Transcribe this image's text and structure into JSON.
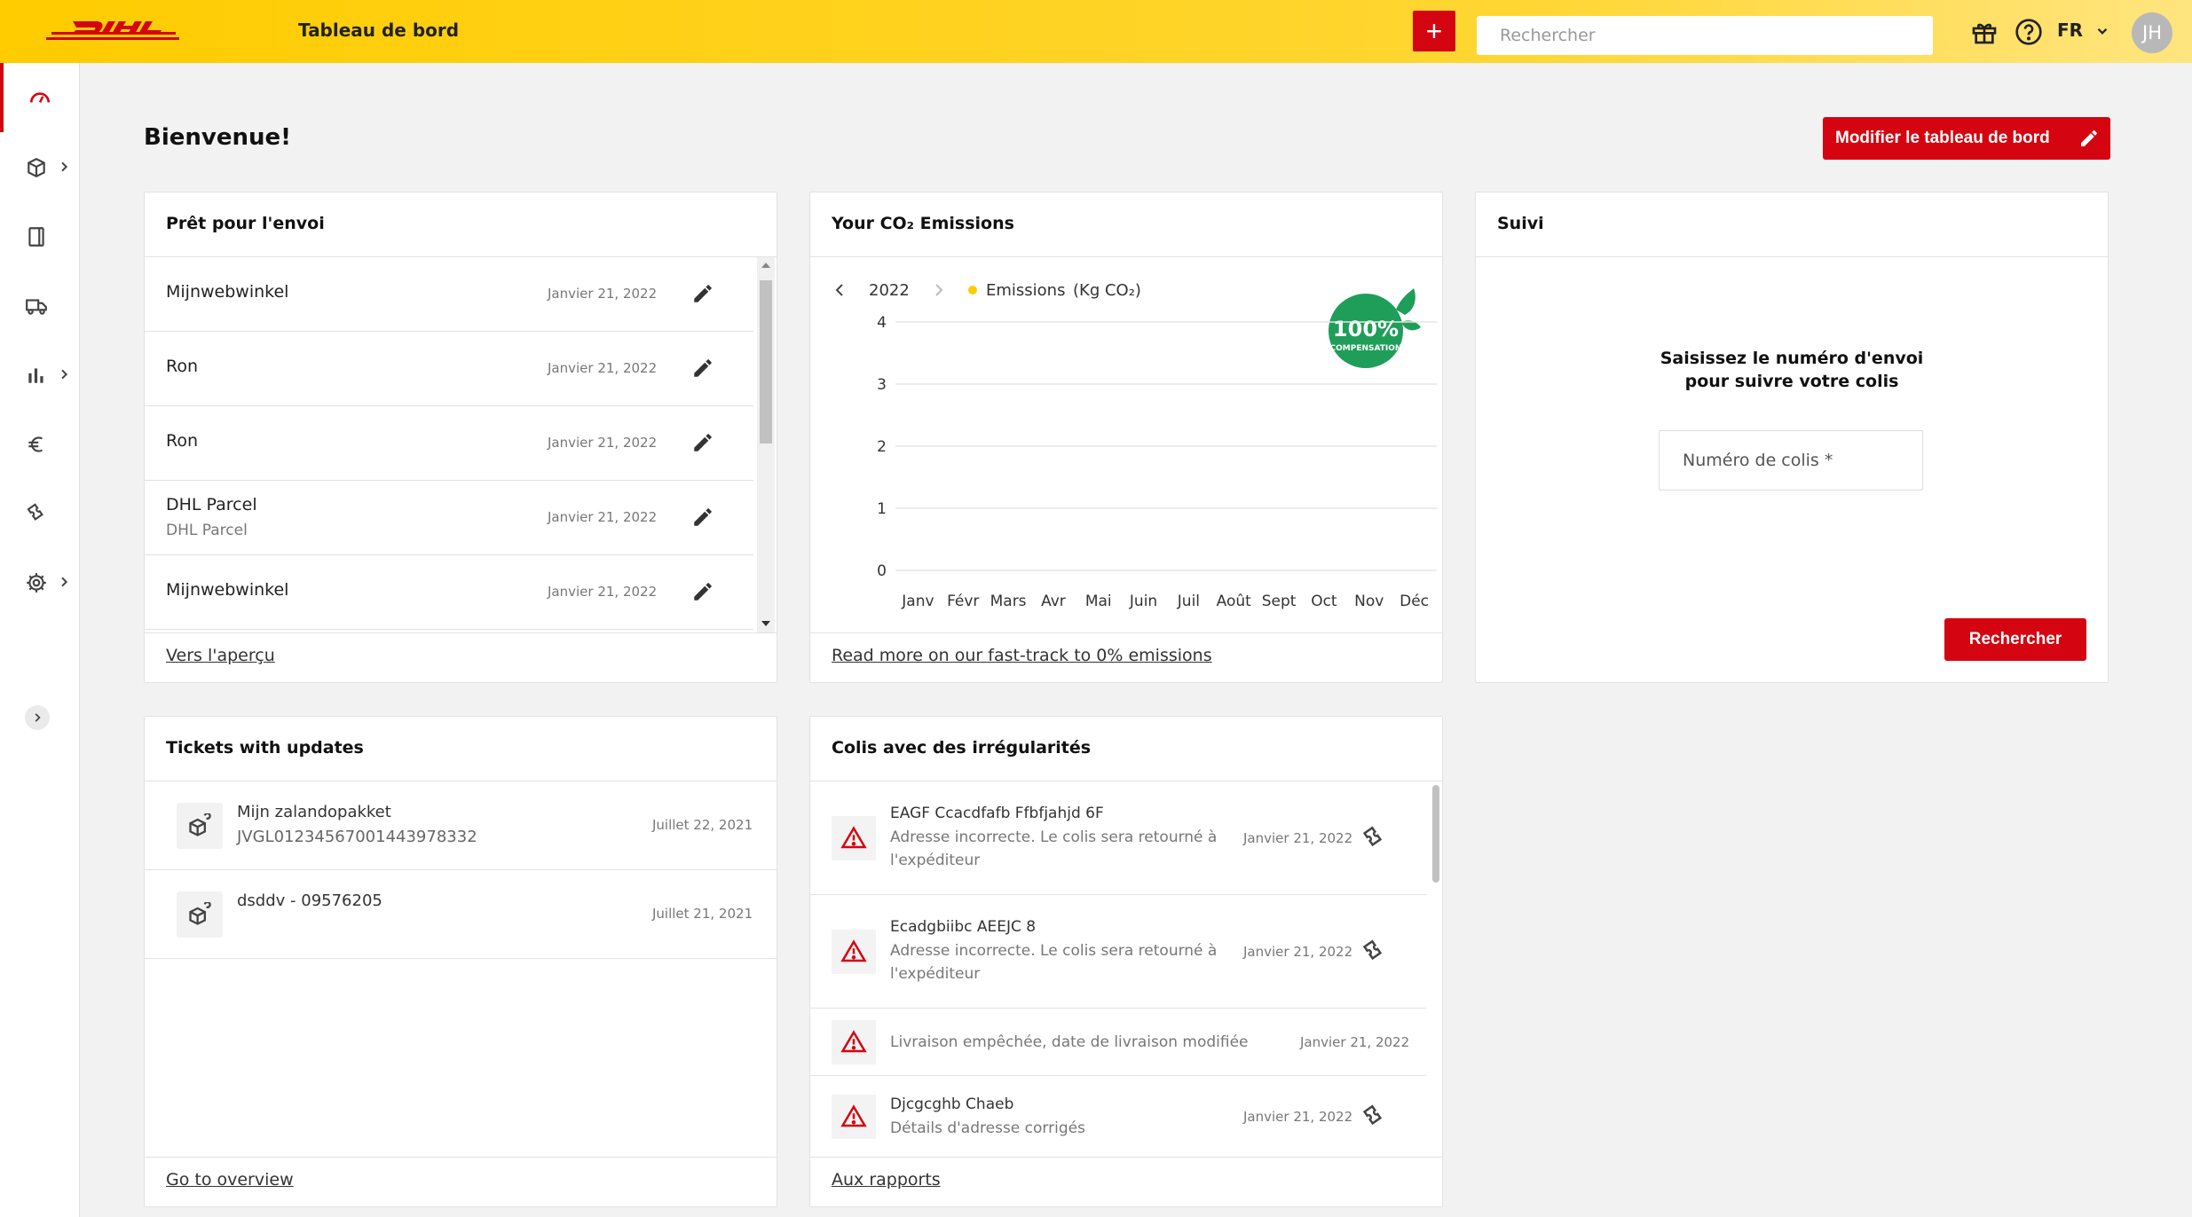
{
  "header": {
    "logo_text": "DHL",
    "title": "Tableau de bord",
    "add_label": "+",
    "search_placeholder": "Rechercher",
    "lang": "FR",
    "avatar": "JH"
  },
  "sidebar": {
    "items": [
      {
        "icon": "dashboard-icon",
        "has_chevron": false
      },
      {
        "icon": "package-icon",
        "has_chevron": true
      },
      {
        "icon": "document-icon",
        "has_chevron": false
      },
      {
        "icon": "truck-icon",
        "has_chevron": false
      },
      {
        "icon": "bar-chart-icon",
        "has_chevron": true
      },
      {
        "icon": "euro-icon",
        "has_chevron": false
      },
      {
        "icon": "ticket-icon",
        "has_chevron": false
      },
      {
        "icon": "gear-icon",
        "has_chevron": true
      }
    ]
  },
  "main": {
    "welcome": "Bienvenue!",
    "edit_dashboard": "Modifier le tableau de bord"
  },
  "ready": {
    "title": "Prêt pour l'envoi",
    "rows": [
      {
        "name": "Mijnwebwinkel",
        "sub": "",
        "date": "Janvier 21, 2022"
      },
      {
        "name": "Ron",
        "sub": "",
        "date": "Janvier 21, 2022"
      },
      {
        "name": "Ron",
        "sub": "",
        "date": "Janvier 21, 2022"
      },
      {
        "name": "DHL Parcel",
        "sub": "DHL Parcel",
        "date": "Janvier 21, 2022"
      },
      {
        "name": "Mijnwebwinkel",
        "sub": "",
        "date": "Janvier 21, 2022"
      }
    ],
    "footer_link": "Vers l'aperçu"
  },
  "co2": {
    "title": "Your CO₂ Emissions",
    "year": "2022",
    "legend": "Emissions",
    "unit": "(Kg CO₂)",
    "badge_big": "100%",
    "badge_small": "COMPENSATION",
    "footer_link": "Read more on our fast-track to 0% emissions",
    "colors": {
      "legend_dot": "#ffcc00",
      "badge": "#1f9e5a"
    }
  },
  "chart_data": {
    "type": "line",
    "title": "Your CO₂ Emissions",
    "categories": [
      "Janv",
      "Févr",
      "Mars",
      "Avr",
      "Mai",
      "Juin",
      "Juil",
      "Août",
      "Sept",
      "Oct",
      "Nov",
      "Déc"
    ],
    "series": [
      {
        "name": "Emissions",
        "values": []
      }
    ],
    "ylabel": "(Kg CO₂)",
    "yticks": [
      0,
      1,
      2,
      3,
      4
    ],
    "ylim": [
      0,
      4
    ],
    "grid": true,
    "legend": "top-left"
  },
  "suivi": {
    "title": "Suivi",
    "line1": "Saisissez le numéro d'envoi",
    "line2": "pour suivre votre colis",
    "input_placeholder": "Numéro de colis *",
    "button": "Rechercher"
  },
  "tickets": {
    "title": "Tickets with updates",
    "rows": [
      {
        "line1": "Mijn zalandopakket",
        "line2": "JVGL01234567001443978332",
        "date": "Juillet 22, 2021"
      },
      {
        "line1": "dsddv - 09576205",
        "line2": "",
        "date": "Juillet 21, 2021"
      }
    ],
    "footer_link": "Go to overview"
  },
  "irregular": {
    "title": "Colis avec des irrégularités",
    "rows": [
      {
        "title": "EAGF Ccacdfafb Ffbfjahjd 6F",
        "l1": "Adresse incorrecte. Le colis sera retourné à",
        "l2": "l'expéditeur",
        "date": "Janvier 21, 2022"
      },
      {
        "title": "Ecadgbiibc AEEJC 8",
        "l1": "Adresse incorrecte. Le colis sera retourné à",
        "l2": "l'expéditeur",
        "date": "Janvier 21, 2022"
      },
      {
        "title": "",
        "l1": "Livraison empêchée, date de livraison modifiée",
        "l2": "",
        "date": "Janvier 21, 2022"
      },
      {
        "title": "Djcgcghb Chaeb",
        "l1": "Détails d'adresse corrigés",
        "l2": "",
        "date": "Janvier 21, 2022"
      }
    ],
    "footer_link": "Aux rapports"
  }
}
